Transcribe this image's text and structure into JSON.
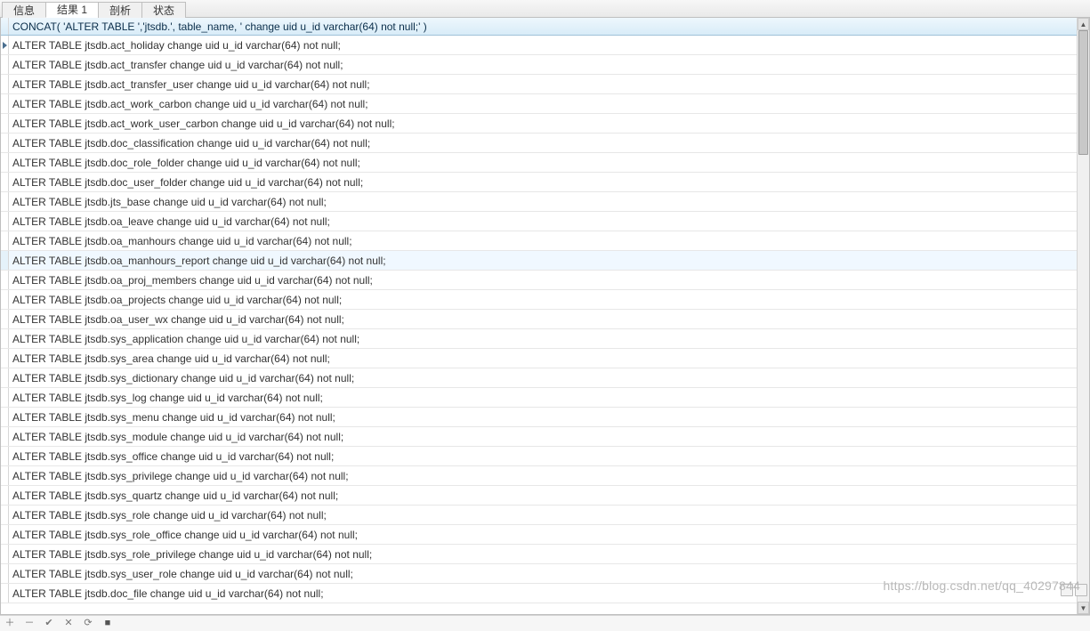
{
  "tabs": [
    {
      "label": "信息",
      "active": false
    },
    {
      "label": "结果 1",
      "active": true
    },
    {
      "label": "剖析",
      "active": false
    },
    {
      "label": "状态",
      "active": false
    }
  ],
  "grid": {
    "header": "CONCAT(        'ALTER TABLE ','jtsdb.',        table_name,        ' change uid u_id varchar(64) not null;'    )",
    "hover_row_index": 11,
    "rows": [
      "ALTER TABLE jtsdb.act_holiday change uid u_id varchar(64) not null;",
      "ALTER TABLE jtsdb.act_transfer change uid u_id varchar(64) not null;",
      "ALTER TABLE jtsdb.act_transfer_user change uid u_id varchar(64) not null;",
      "ALTER TABLE jtsdb.act_work_carbon change uid u_id varchar(64) not null;",
      "ALTER TABLE jtsdb.act_work_user_carbon change uid u_id varchar(64) not null;",
      "ALTER TABLE jtsdb.doc_classification change uid u_id varchar(64) not null;",
      "ALTER TABLE jtsdb.doc_role_folder change uid u_id varchar(64) not null;",
      "ALTER TABLE jtsdb.doc_user_folder change uid u_id varchar(64) not null;",
      "ALTER TABLE jtsdb.jts_base change uid u_id varchar(64) not null;",
      "ALTER TABLE jtsdb.oa_leave change uid u_id varchar(64) not null;",
      "ALTER TABLE jtsdb.oa_manhours change uid u_id varchar(64) not null;",
      "ALTER TABLE jtsdb.oa_manhours_report change uid u_id varchar(64) not null;",
      "ALTER TABLE jtsdb.oa_proj_members change uid u_id varchar(64) not null;",
      "ALTER TABLE jtsdb.oa_projects change uid u_id varchar(64) not null;",
      "ALTER TABLE jtsdb.oa_user_wx change uid u_id varchar(64) not null;",
      "ALTER TABLE jtsdb.sys_application change uid u_id varchar(64) not null;",
      "ALTER TABLE jtsdb.sys_area change uid u_id varchar(64) not null;",
      "ALTER TABLE jtsdb.sys_dictionary change uid u_id varchar(64) not null;",
      "ALTER TABLE jtsdb.sys_log change uid u_id varchar(64) not null;",
      "ALTER TABLE jtsdb.sys_menu change uid u_id varchar(64) not null;",
      "ALTER TABLE jtsdb.sys_module change uid u_id varchar(64) not null;",
      "ALTER TABLE jtsdb.sys_office change uid u_id varchar(64) not null;",
      "ALTER TABLE jtsdb.sys_privilege change uid u_id varchar(64) not null;",
      "ALTER TABLE jtsdb.sys_quartz change uid u_id varchar(64) not null;",
      "ALTER TABLE jtsdb.sys_role change uid u_id varchar(64) not null;",
      "ALTER TABLE jtsdb.sys_role_office change uid u_id varchar(64) not null;",
      "ALTER TABLE jtsdb.sys_role_privilege change uid u_id varchar(64) not null;",
      "ALTER TABLE jtsdb.sys_user_role change uid u_id varchar(64) not null;",
      "ALTER TABLE jtsdb.doc_file change uid u_id varchar(64) not null;"
    ]
  },
  "footer_icons": {
    "plus": "＋",
    "minus": "－",
    "check": "✔",
    "x": "✕",
    "refresh": "⟳",
    "stop": "■"
  },
  "watermark": "https://blog.csdn.net/qq_40297844"
}
